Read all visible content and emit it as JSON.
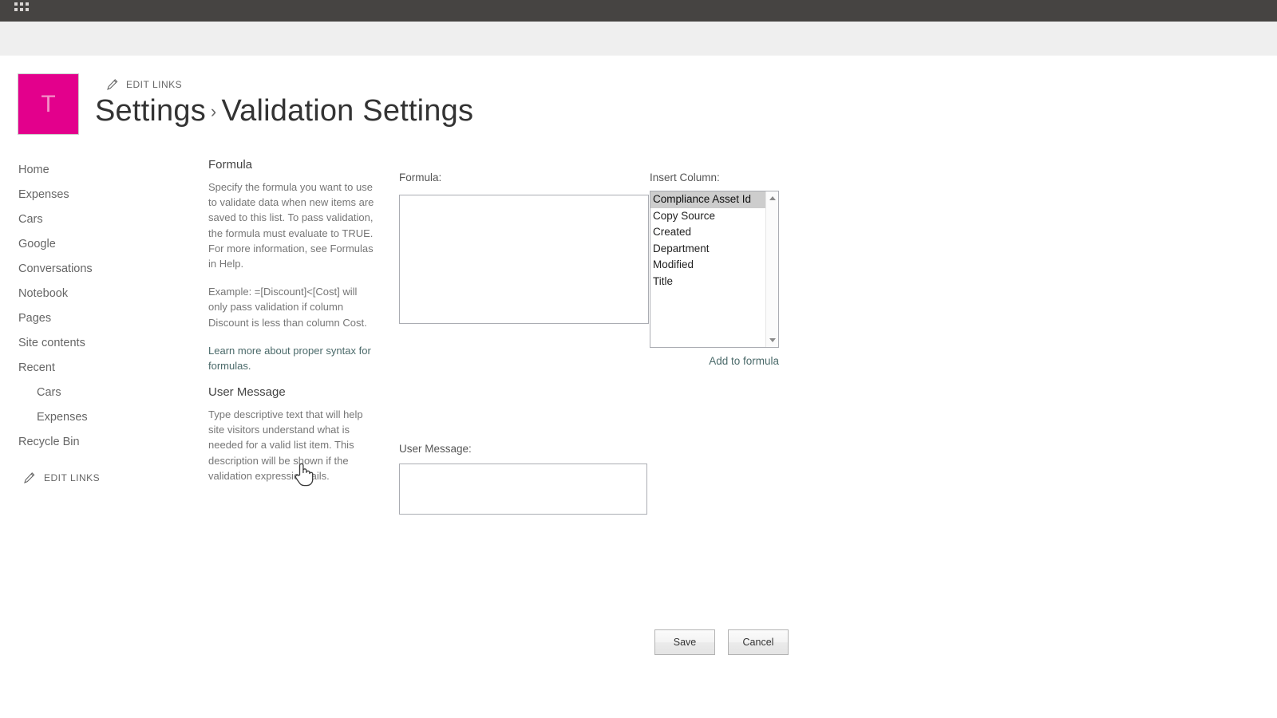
{
  "suite": {
    "waffle_icon": "app-launcher-waffle-icon"
  },
  "header": {
    "logo_letter": "T",
    "edit_links_label": "EDIT LINKS",
    "title_parent": "Settings",
    "title_separator": "›",
    "title_current": "Validation Settings"
  },
  "sidebar": {
    "items": [
      {
        "label": "Home",
        "sub": false
      },
      {
        "label": "Expenses",
        "sub": false
      },
      {
        "label": "Cars",
        "sub": false
      },
      {
        "label": "Google",
        "sub": false
      },
      {
        "label": "Conversations",
        "sub": false
      },
      {
        "label": "Notebook",
        "sub": false
      },
      {
        "label": "Pages",
        "sub": false
      },
      {
        "label": "Site contents",
        "sub": false
      },
      {
        "label": "Recent",
        "sub": false
      },
      {
        "label": "Cars",
        "sub": true
      },
      {
        "label": "Expenses",
        "sub": true
      },
      {
        "label": "Recycle Bin",
        "sub": false
      }
    ],
    "edit_links_label": "EDIT LINKS"
  },
  "formula_section": {
    "heading": "Formula",
    "paragraph_1": "Specify the formula you want to use to validate data when new items are saved to this list. To pass validation, the formula must evaluate to TRUE. For more information, see Formulas in Help.",
    "paragraph_2": "Example: =[Discount]<[Cost] will only pass validation if column Discount is less than column Cost.",
    "help_link": "Learn more about proper syntax for formulas.",
    "field_label": "Formula:",
    "field_value": "",
    "insert_column_label": "Insert Column:",
    "insert_column_options": [
      "Compliance Asset Id",
      "Copy Source",
      "Created",
      "Department",
      "Modified",
      "Title"
    ],
    "insert_column_selected": "Compliance Asset Id",
    "add_to_formula_label": "Add to formula"
  },
  "user_message_section": {
    "heading": "User Message",
    "paragraph": "Type descriptive text that will help site visitors understand what is needed for a valid list item. This description will be shown if the validation expression fails.",
    "field_label": "User Message:",
    "field_value": ""
  },
  "actions": {
    "save_label": "Save",
    "cancel_label": "Cancel"
  },
  "theme": {
    "suitebar_bg": "#464442",
    "ribbon_bg": "#efefef",
    "logo_bg": "#e3008c",
    "link_color": "#4b6a6a",
    "selection_bg": "#cdcdcd"
  }
}
